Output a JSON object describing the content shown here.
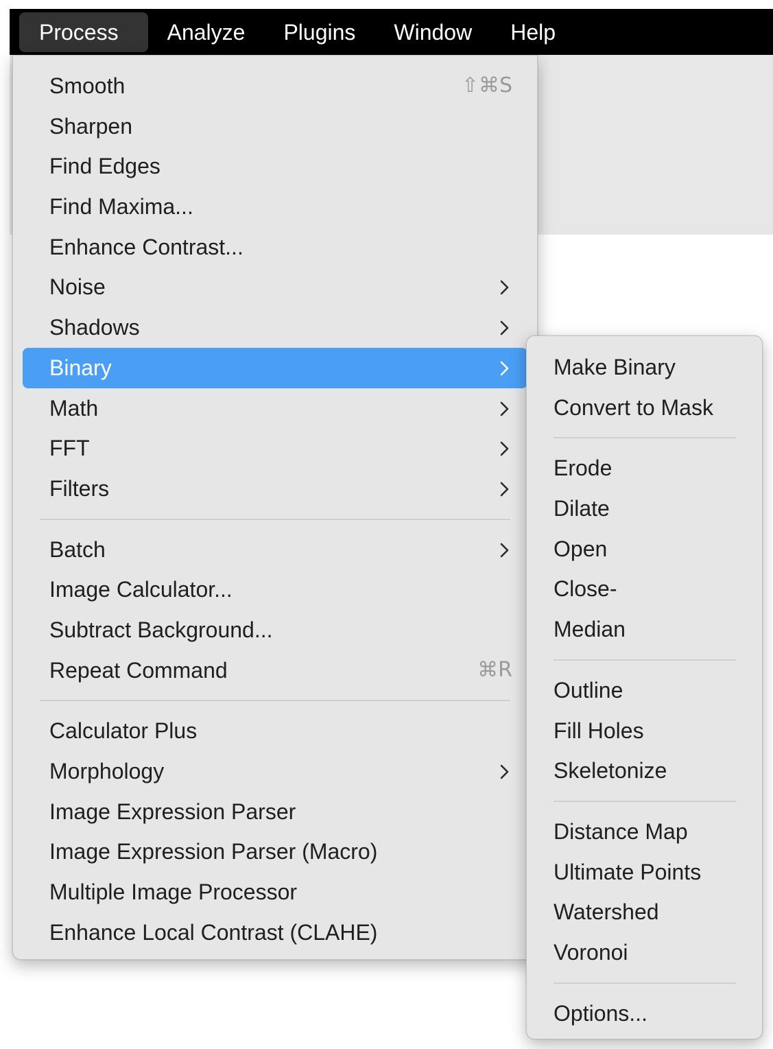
{
  "menubar": {
    "items": [
      "Process",
      "Analyze",
      "Plugins",
      "Window",
      "Help"
    ],
    "active": "Process"
  },
  "process_menu": {
    "items": [
      {
        "label": "Smooth",
        "shortcut": "⇧⌘S"
      },
      {
        "label": "Sharpen"
      },
      {
        "label": "Find Edges"
      },
      {
        "label": "Find Maxima..."
      },
      {
        "label": "Enhance Contrast..."
      },
      {
        "label": "Noise",
        "submenu": true
      },
      {
        "label": "Shadows",
        "submenu": true
      },
      {
        "label": "Binary",
        "submenu": true,
        "highlighted": true
      },
      {
        "label": "Math",
        "submenu": true
      },
      {
        "label": "FFT",
        "submenu": true
      },
      {
        "label": "Filters",
        "submenu": true
      },
      {
        "separator": true
      },
      {
        "label": "Batch",
        "submenu": true
      },
      {
        "label": "Image Calculator..."
      },
      {
        "label": "Subtract Background..."
      },
      {
        "label": "Repeat Command",
        "shortcut": "⌘R"
      },
      {
        "separator": true
      },
      {
        "label": "Calculator Plus"
      },
      {
        "label": "Morphology",
        "submenu": true
      },
      {
        "label": "Image Expression Parser"
      },
      {
        "label": "Image Expression Parser (Macro)"
      },
      {
        "label": "Multiple Image Processor"
      },
      {
        "label": "Enhance Local Contrast (CLAHE)"
      }
    ]
  },
  "binary_submenu": {
    "items": [
      {
        "label": "Make Binary"
      },
      {
        "label": "Convert to Mask"
      },
      {
        "separator": true
      },
      {
        "label": "Erode"
      },
      {
        "label": "Dilate"
      },
      {
        "label": "Open"
      },
      {
        "label": "Close-"
      },
      {
        "label": "Median"
      },
      {
        "separator": true
      },
      {
        "label": "Outline"
      },
      {
        "label": "Fill Holes"
      },
      {
        "label": "Skeletonize"
      },
      {
        "separator": true
      },
      {
        "label": "Distance Map"
      },
      {
        "label": "Ultimate Points"
      },
      {
        "label": "Watershed"
      },
      {
        "label": "Voronoi"
      },
      {
        "separator": true
      },
      {
        "label": "Options..."
      }
    ]
  },
  "colors": {
    "menubar_bg": "#000000",
    "menu_bg": "#e6e6e6",
    "highlight": "#4a9ff5",
    "shortcut_text": "#9a9a9a"
  },
  "icons": {
    "submenu_indicator": "chevron-right-icon"
  }
}
